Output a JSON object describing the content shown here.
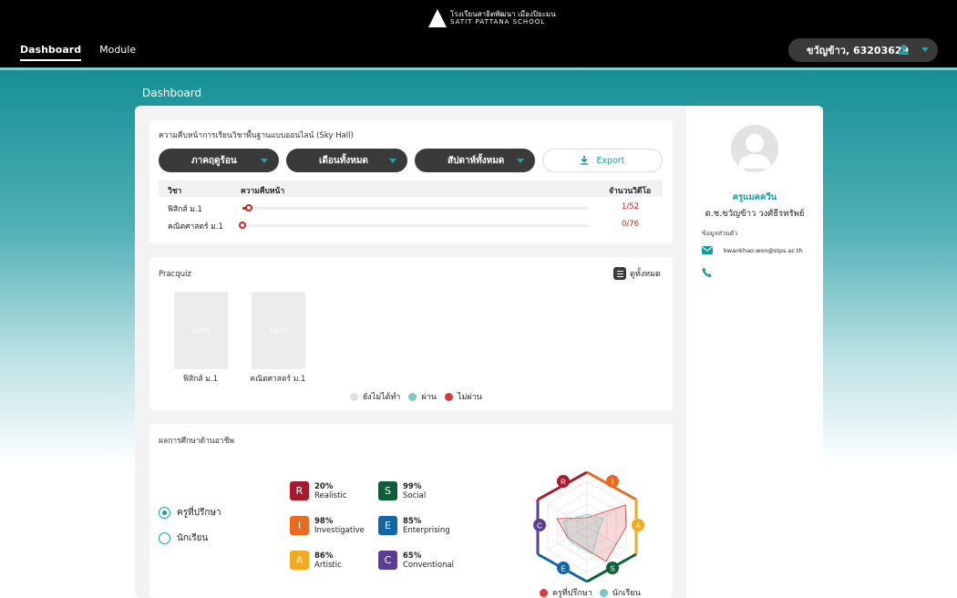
{
  "header": {
    "logo_line1": "โรงเรียนสาธิตพัฒนา เมืองปิยะมน",
    "logo_line2": "SATIT PATTANA SCHOOL",
    "nav_tabs": [
      {
        "label": "Dashboard",
        "active": true
      },
      {
        "label": "Module",
        "active": false
      }
    ],
    "user_label": "ขวัญข้าว, 63203629"
  },
  "page_title": "Dashboard",
  "progress_card": {
    "title": "ความคืบหน้าการเรียนวิชาพื้นฐานแบบออนไลน์ (Sky Hall)",
    "filters": [
      {
        "label": "ภาคฤดูร้อน"
      },
      {
        "label": "เดือนทั้งหมด"
      },
      {
        "label": "สัปดาห์ทั้งหมด"
      }
    ],
    "export_label": "Export",
    "columns": [
      "วิชา",
      "ความคืบหน้า",
      "จำนวนวิดีโอ"
    ],
    "rows": [
      {
        "subject": "ฟิสิกส์ ม.1",
        "progress": 0.019,
        "count": "1/52"
      },
      {
        "subject": "คณิตศาสตร์ ม.1",
        "progress": 0.0,
        "count": "0/76"
      }
    ]
  },
  "pracquiz": {
    "title": "Pracquiz",
    "view_all": "ดูทั้งหมด",
    "items": [
      {
        "label": "ฟิสิกส์ ม.1",
        "percent": "100%"
      },
      {
        "label": "คณิตศาสตร์ ม.1",
        "percent": "100%"
      }
    ],
    "legend": [
      {
        "label": "ยังไม่ได้ทำ",
        "color": "#e0e0e0"
      },
      {
        "label": "ผ่าน",
        "color": "#7cc8c4"
      },
      {
        "label": "ไม่ผ่าน",
        "color": "#d63a3a"
      }
    ]
  },
  "career": {
    "title": "ผลการศึกษาด้านอาชีพ",
    "options": [
      {
        "label": "ครูที่ปรึกษา",
        "selected": true
      },
      {
        "label": "นักเรียน",
        "selected": false
      }
    ],
    "riasec": [
      {
        "letter": "R",
        "percent": "20%",
        "name": "Realistic",
        "color": "#a8192e"
      },
      {
        "letter": "S",
        "percent": "99%",
        "name": "Social",
        "color": "#0e5e3a"
      },
      {
        "letter": "I",
        "percent": "98%",
        "name": "Investigative",
        "color": "#ea6a1f"
      },
      {
        "letter": "E",
        "percent": "85%",
        "name": "Enterprising",
        "color": "#1166a8"
      },
      {
        "letter": "A",
        "percent": "86%",
        "name": "Artistic",
        "color": "#f2a91e"
      },
      {
        "letter": "C",
        "percent": "65%",
        "name": "Conventional",
        "color": "#5b3e94"
      }
    ],
    "radar_legend": [
      {
        "label": "ครูที่ปรึกษา",
        "color": "#d63a3a"
      },
      {
        "label": "นักเรียน",
        "color": "#7cc8c4"
      }
    ]
  },
  "profile": {
    "role": "ครูแมคควีน",
    "full_name": "ด.ช.ขวัญข้าว วงศ์ธีรทรัพย์",
    "contact_heading": "ข้อมูลส่วนตัว",
    "email": "kwankhao.won@stps.ac.th"
  }
}
